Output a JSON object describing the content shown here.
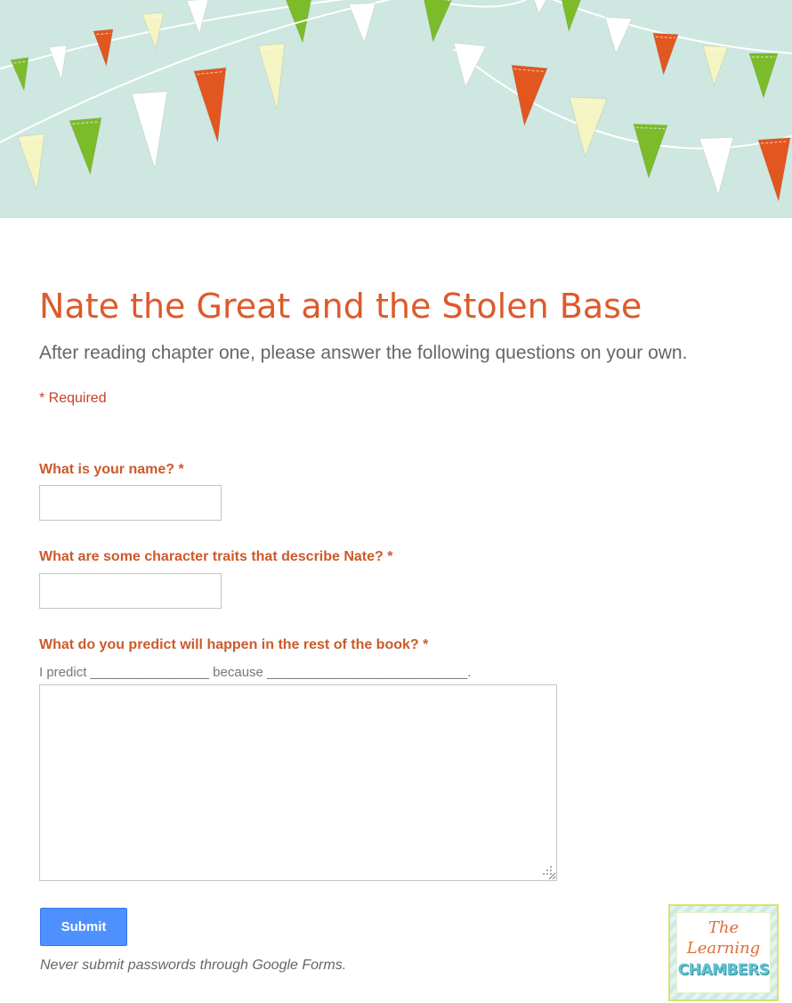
{
  "colors": {
    "banner_bg": "#cfe7e1",
    "flag_green": "#7cbc2a",
    "flag_orange": "#e2571f",
    "flag_cream": "#f5f5c4",
    "flag_white": "#ffffff",
    "title": "#dd5a2b",
    "question": "#cc5a2b",
    "submit": "#4d90fe"
  },
  "form": {
    "title": "Nate the Great and the Stolen Base",
    "description": "After reading chapter one, please answer the following questions on your own.",
    "required_note": "* Required"
  },
  "questions": [
    {
      "label": "What is your name? *",
      "value": ""
    },
    {
      "label": "What are some character traits that describe Nate? *",
      "value": ""
    },
    {
      "label": "What do you predict will happen in the rest of the book? *",
      "help": "I predict ________________ because ___________________________.",
      "value": ""
    }
  ],
  "submit": {
    "label": "Submit"
  },
  "footer": {
    "note": "Never submit passwords through Google Forms."
  },
  "logo": {
    "line1": "The",
    "line2": "Learning",
    "line3": "CHAMBERS"
  }
}
